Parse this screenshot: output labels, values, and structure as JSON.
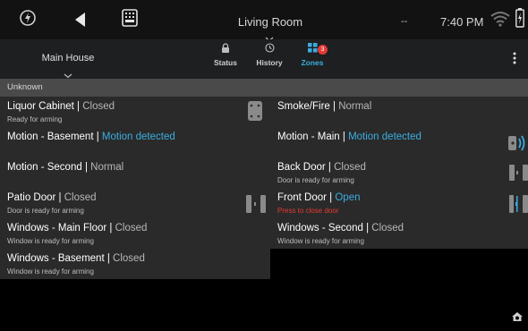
{
  "topbar": {
    "title": "Living Room",
    "dash": "--",
    "time": "7:40 PM"
  },
  "subbar": {
    "location": "Main House",
    "tabs": [
      {
        "label": "Status",
        "icon": "lock-icon"
      },
      {
        "label": "History",
        "icon": "clock-icon"
      },
      {
        "label": "Zones",
        "icon": "grid-icon",
        "badge": "3"
      }
    ],
    "accent": "#3aaee0",
    "badge_color": "#e53935"
  },
  "section": {
    "title": "Unknown"
  },
  "zones": [
    {
      "name": "Liquor Cabinet",
      "status": "Closed",
      "sub": "Ready for arming"
    },
    {
      "name": "Smoke/Fire",
      "status": "Normal",
      "sub": ""
    },
    {
      "name": "Motion - Basement",
      "status": "Motion detected",
      "sub": ""
    },
    {
      "name": "Motion - Main",
      "status": "Motion detected",
      "sub": ""
    },
    {
      "name": "Motion - Second",
      "status": "Normal",
      "sub": ""
    },
    {
      "name": "Back Door",
      "status": "Closed",
      "sub": "Door is ready for arming"
    },
    {
      "name": "Patio Door",
      "status": "Closed",
      "sub": "Door is ready for arming"
    },
    {
      "name": "Front Door",
      "status": "Open",
      "sub": "Press to close door"
    },
    {
      "name": "Windows - Main Floor",
      "status": "Closed",
      "sub": "Window is ready for arming"
    },
    {
      "name": "Windows - Second",
      "status": "Closed",
      "sub": "Window is ready for arming"
    },
    {
      "name": "Windows - Basement",
      "status": "Closed",
      "sub": "Window is ready for arming"
    }
  ]
}
